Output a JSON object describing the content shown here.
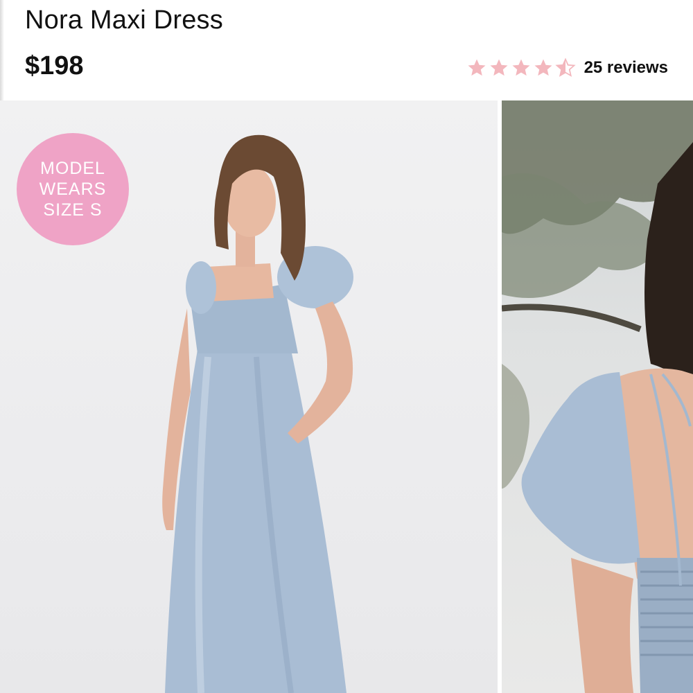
{
  "product": {
    "title": "Nora Maxi Dress",
    "price": "$198",
    "rating": 4.5,
    "rating_max": 5,
    "reviews_label": "25 reviews"
  },
  "gallery": {
    "badge_text": "MODEL\nWEARS\nSIZE S"
  },
  "colors": {
    "star": "#f3b7bd",
    "badge": "#efa3c6",
    "dress": "#a9bdd4"
  }
}
